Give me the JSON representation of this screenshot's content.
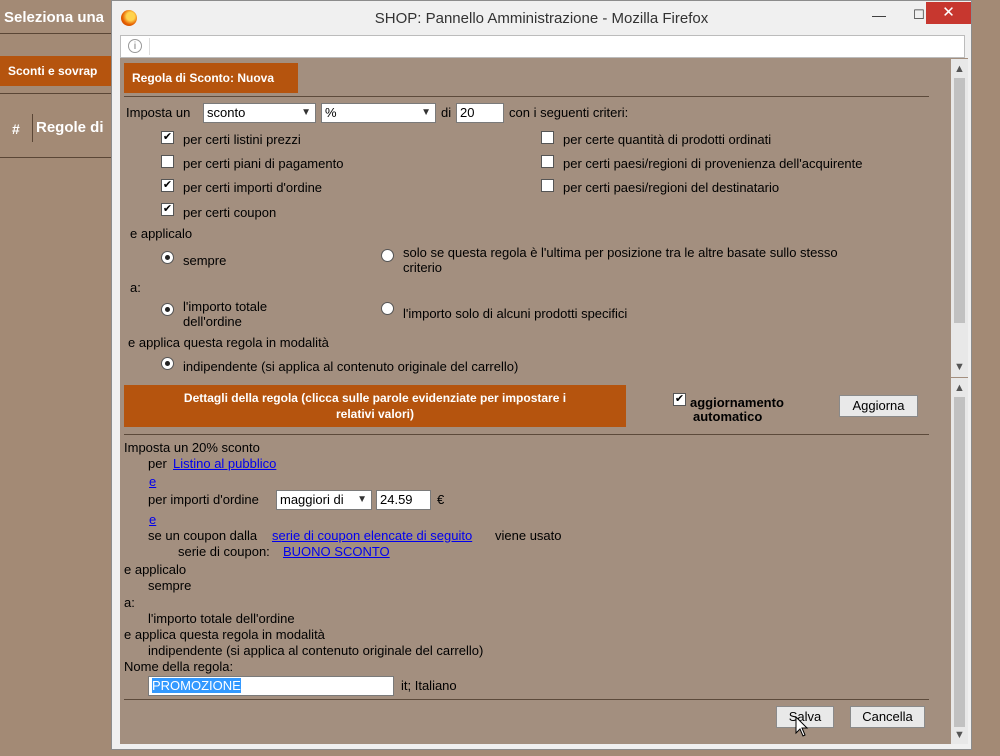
{
  "background": {
    "title": "Seleziona una",
    "tab": "Sconti e sovrap",
    "hash": "#",
    "rules": "Regole di"
  },
  "window": {
    "title": "SHOP: Pannello Amministrazione - Mozilla Firefox",
    "minimize": "—",
    "maximize": "☐",
    "close": "✕"
  },
  "rule_panel": {
    "header": "Regola di Sconto: Nuova",
    "set_prefix": "Imposta un",
    "type_value": "sconto",
    "unit_value": "%",
    "of_label": "di",
    "amount_value": "20",
    "criteria_suffix": "con i seguenti criteri:",
    "criteria_left": [
      {
        "label": "per certi listini prezzi",
        "checked": true
      },
      {
        "label": "per certi piani di pagamento",
        "checked": false
      },
      {
        "label": "per certi importi d'ordine",
        "checked": true
      },
      {
        "label": "per certi coupon",
        "checked": true
      }
    ],
    "criteria_right": [
      {
        "label": "per certe quantità di prodotti ordinati",
        "checked": false
      },
      {
        "label": "per certi paesi/regioni di provenienza dell'acquirente",
        "checked": false
      },
      {
        "label": "per certi paesi/regioni del destinatario",
        "checked": false
      }
    ],
    "apply_label": "e applicalo",
    "apply_always": "sempre",
    "apply_last_line1": "solo se questa regola è l'ultima per posizione tra le altre basate sullo stesso",
    "apply_last_line2": "criterio",
    "to_label": "a:",
    "to_total_line1": "l'importo totale",
    "to_total_line2": "dell'ordine",
    "to_specific": "l'importo solo di alcuni prodotti specifici",
    "mode_label": "e applica questa regola in modalità",
    "mode_independent": "indipendente (si applica al contenuto originale del carrello)"
  },
  "details": {
    "header_line1": "Dettagli della regola (clicca sulle parole evidenziate per impostare i",
    "header_line2": "relativi valori)",
    "auto_update_line1": "aggiornamento",
    "auto_update_line2": "automatico",
    "auto_update_checked": true,
    "update_button": "Aggiorna",
    "line1": "Imposta un 20% sconto",
    "for_label": "per",
    "price_list_link": "Listino al pubblico",
    "and1": "e",
    "order_amount_label": "per importi d'ordine",
    "comparator_value": "maggiori di",
    "order_amount_value": "24.59",
    "currency": "€",
    "and2": "e",
    "coupon_prefix": "se un coupon dalla",
    "coupon_series_link": "serie di coupon elencate di seguito",
    "coupon_suffix": "viene usato",
    "coupon_series_label": "serie di coupon:",
    "coupon_name_link": "BUONO SCONTO",
    "apply_label": "e applicalo",
    "apply_value": "sempre",
    "to_label": "a:",
    "to_value": "l'importo totale dell'ordine",
    "mode_label": "e applica questa regola in modalità",
    "mode_value": "indipendente (si applica al contenuto originale del carrello)",
    "rule_name_label": "Nome della regola:",
    "rule_name_value": "PROMOZIONE",
    "language": "it; Italiano"
  },
  "footer": {
    "save": "Salva",
    "cancel": "Cancella"
  },
  "icons": {
    "scroll_up": "▲",
    "scroll_down": "▼",
    "info": "i"
  }
}
